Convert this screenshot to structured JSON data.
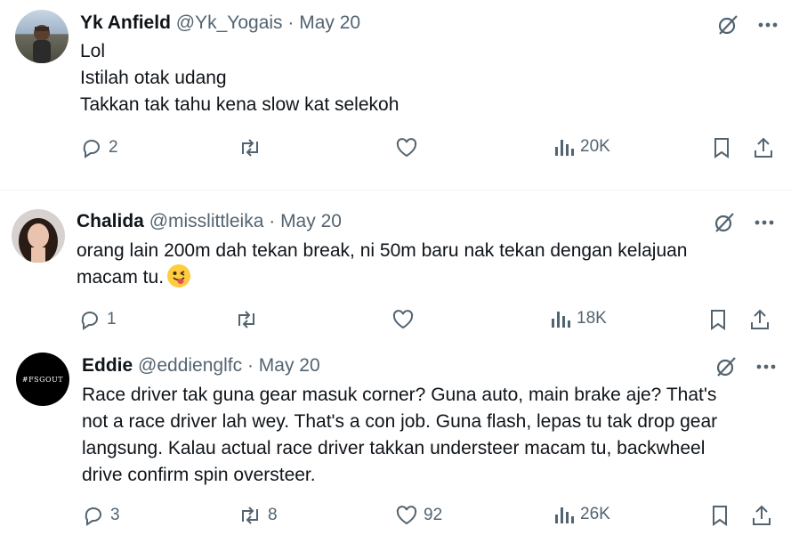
{
  "tweets": [
    {
      "name": "Yk Anfield",
      "handle": "@Yk_Yogais",
      "separator": "·",
      "date": "May 20",
      "lines": [
        "Lol",
        "Istilah otak udang",
        "Takkan tak tahu kena slow kat selekoh"
      ],
      "replies": "2",
      "retweets": "",
      "likes": "",
      "views": "20K"
    },
    {
      "name": "Chalida",
      "handle": "@misslittleika",
      "separator": "·",
      "date": "May 20",
      "lines": [
        "orang lain 200m dah tekan break, ni 50m baru nak tekan dengan kelajuan",
        "macam tu."
      ],
      "replies": "1",
      "retweets": "",
      "likes": "",
      "views": "18K"
    },
    {
      "name": "Eddie",
      "handle": "@eddienglfc",
      "separator": "·",
      "date": "May 20",
      "avatar_text": "#FSGOUT",
      "lines": [
        "Race driver tak guna gear masuk corner? Guna auto, main brake aje? That's",
        "not a race driver lah wey. That's a con job. Guna flash, lepas tu tak drop gear",
        "langsung. Kalau actual race driver takkan understeer macam tu, backwheel",
        "drive confirm spin oversteer."
      ],
      "replies": "3",
      "retweets": "8",
      "likes": "92",
      "views": "26K"
    }
  ],
  "icons": [
    "grok-icon",
    "more-icon",
    "reply-icon",
    "retweet-icon",
    "like-icon",
    "views-icon",
    "bookmark-icon",
    "share-icon",
    "tongue-wink-emoji"
  ],
  "colors": {
    "text": "#0f1419",
    "muted": "#536471",
    "divider": "#eff3f4"
  }
}
